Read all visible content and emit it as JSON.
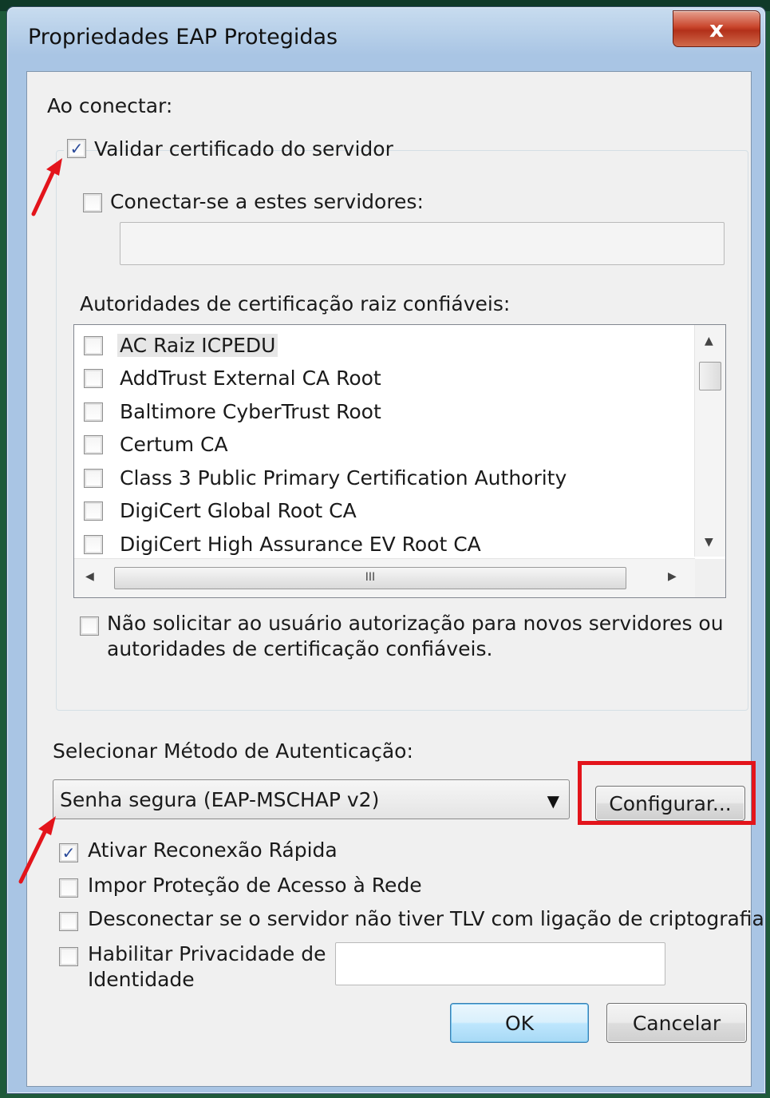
{
  "window": {
    "title": "Propriedades EAP Protegidas",
    "close_glyph": "x"
  },
  "connect_section": {
    "heading": "Ao conectar:",
    "validate_cert": {
      "label": "Validar certificado do servidor",
      "checked": true
    },
    "connect_servers": {
      "label": "Conectar-se a estes servidores:",
      "checked": false,
      "value": ""
    },
    "trusted_roots_label": "Autoridades de certificação raiz confiáveis:",
    "trusted_roots": [
      {
        "label": "AC Raiz ICPEDU",
        "checked": false
      },
      {
        "label": "AddTrust External CA Root",
        "checked": false
      },
      {
        "label": "Baltimore CyberTrust Root",
        "checked": false
      },
      {
        "label": "Certum CA",
        "checked": false
      },
      {
        "label": "Class 3 Public Primary Certification Authority",
        "checked": false
      },
      {
        "label": "DigiCert Global Root CA",
        "checked": false
      },
      {
        "label": "DigiCert High Assurance EV Root CA",
        "checked": false
      }
    ],
    "hscroll_grip": "III",
    "no_prompt": {
      "line1": "Não solicitar ao usuário autorização para novos servidores ou",
      "line2": "autoridades de certificação confiáveis.",
      "checked": false
    }
  },
  "auth_method": {
    "label": "Selecionar Método de Autenticação:",
    "selected": "Senha segura (EAP-MSCHAP v2)",
    "configure_label": "Configurar..."
  },
  "options": {
    "fast_reconnect": {
      "label": "Ativar Reconexão Rápida",
      "checked": true
    },
    "nap": {
      "label": "Impor Proteção de Acesso à Rede",
      "checked": false
    },
    "tlv": {
      "label": "Desconectar se o servidor não tiver TLV com ligação de criptografia",
      "checked": false
    },
    "identity_privacy": {
      "line1": "Habilitar Privacidade de",
      "line2": "Identidade",
      "checked": false,
      "value": ""
    }
  },
  "buttons": {
    "ok": "OK",
    "cancel": "Cancelar"
  },
  "colors": {
    "annotation_red": "#e3141b",
    "check_blue": "#2a4a9a"
  }
}
